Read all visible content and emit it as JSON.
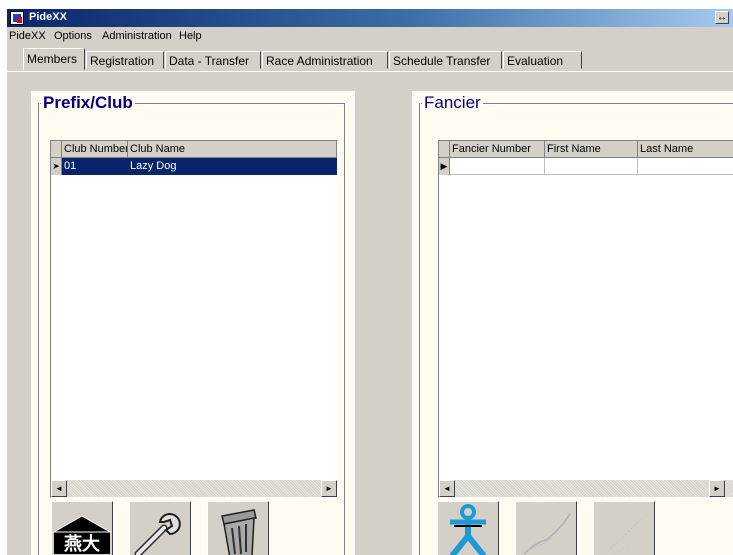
{
  "window": {
    "title": "PideXX",
    "restore_glyph": "↔"
  },
  "menu": [
    "PideXX",
    "Options",
    "Administration",
    "Help"
  ],
  "tabs": [
    "Members",
    "Registration",
    "Data - Transfer",
    "Race Administration",
    "Schedule Transfer",
    "Evaluation"
  ],
  "active_tab": "Members",
  "prefix_club": {
    "title": "Prefix/Club",
    "columns": [
      "Club Number",
      "Club Name"
    ],
    "rows": [
      {
        "club_number": "01",
        "club_name": "Lazy Dog"
      }
    ]
  },
  "fancier": {
    "title": "Fancier",
    "columns": [
      "Fancier Number",
      "First Name",
      "Last Name"
    ],
    "rows": []
  },
  "scroll_glyphs": {
    "left": "◄",
    "right": "►"
  },
  "row_markers": {
    "current": "➤",
    "new": "▶"
  },
  "icons": {
    "club_buttons": [
      "club-house-icon",
      "wrench-icon",
      "trash-can-icon"
    ],
    "fancier_buttons": [
      "fancier-person-icon",
      "bird-icon",
      "bird-sketch-icon"
    ]
  }
}
